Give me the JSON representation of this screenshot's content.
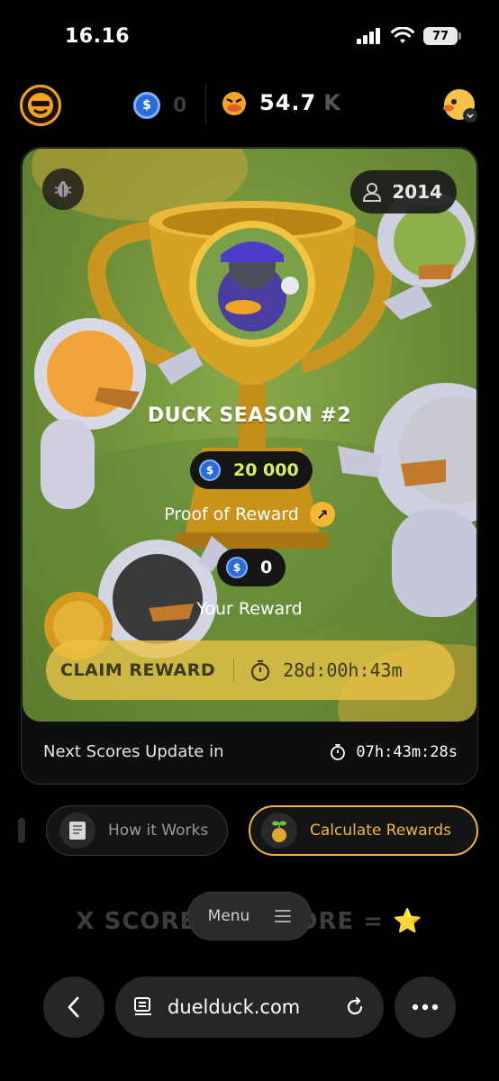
{
  "status_bar": {
    "time": "16.16",
    "battery": "77"
  },
  "header": {
    "coins": "0",
    "duck_points": "54.7",
    "duck_points_unit": "K"
  },
  "season": {
    "players_count": "2014",
    "title": "DUCK SEASON #2",
    "prize_pool": "20 000",
    "proof_label": "Proof of Reward",
    "your_reward_value": "0",
    "your_reward_label": "Your Reward",
    "claim_label": "CLAIM REWARD",
    "claim_timer": "28d:00h:43m",
    "scores_update_label": "Next Scores Update in",
    "scores_update_timer": "07h:43m:28s"
  },
  "actions": {
    "how_it_works": "How it Works",
    "calculate_rewards": "Calculate Rewards"
  },
  "formula": {
    "left": "X SCORE",
    "right": "ORE = ",
    "star": "⭐"
  },
  "menu": {
    "label": "Menu"
  },
  "browser": {
    "url": "duelduck.com"
  },
  "colors": {
    "accent": "#f2b53a",
    "pool_text": "#d8f05a",
    "coin_blue": "#2b6bd6",
    "card_green": "#6b8d36"
  }
}
